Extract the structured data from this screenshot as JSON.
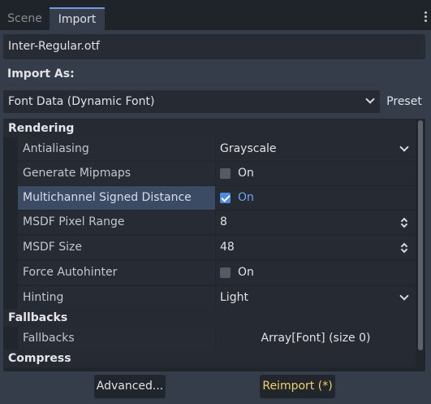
{
  "tabs": [
    {
      "label": "Scene",
      "active": false
    },
    {
      "label": "Import",
      "active": true
    }
  ],
  "file": {
    "name": "Inter-Regular.otf"
  },
  "import_as": {
    "heading": "Import As:",
    "selected": "Font Data (Dynamic Font)",
    "preset_label": "Preset"
  },
  "sections": {
    "rendering": "Rendering",
    "fallbacks": "Fallbacks",
    "compress": "Compress"
  },
  "properties": {
    "antialiasing": {
      "label": "Antialiasing",
      "value": "Grayscale"
    },
    "generate_mipmaps": {
      "label": "Generate Mipmaps",
      "checked": false,
      "value_label": "On"
    },
    "msdf": {
      "label": "Multichannel Signed Distance Field",
      "checked": true,
      "value_label": "On"
    },
    "msdf_pixel_range": {
      "label": "MSDF Pixel Range",
      "value": "8"
    },
    "msdf_size": {
      "label": "MSDF Size",
      "value": "48"
    },
    "force_autohinter": {
      "label": "Force Autohinter",
      "checked": false,
      "value_label": "On"
    },
    "hinting": {
      "label": "Hinting",
      "value": "Light"
    },
    "fallbacks": {
      "label": "Fallbacks",
      "value": "Array[Font] (size 0)"
    }
  },
  "buttons": {
    "advanced": "Advanced...",
    "reimport": "Reimport (*)"
  },
  "colors": {
    "accent": "#4f8be6",
    "reimport_text": "#f0d46a",
    "highlight_row": "#3a4b63"
  }
}
